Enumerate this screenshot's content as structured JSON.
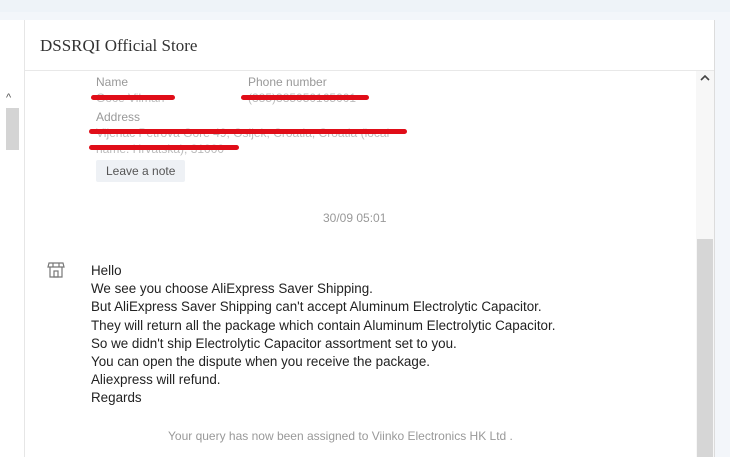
{
  "store": {
    "title": "DSSRQI Official Store"
  },
  "contact": {
    "name_label": "Name",
    "name_value": "Goce Vilman",
    "phone_label": "Phone number",
    "phone_value": "(385)385050165001",
    "address_label": "Address",
    "address_line1": "Vijenac Petrova Gore 49, Osijek, Croatia, Croatia (local",
    "address_line2": "name: Hrvatska), 31000",
    "note_button": "Leave a note"
  },
  "timestamp": "30/09 05:01",
  "message": {
    "lines": [
      "Hello",
      "We see you choose AliExpress Saver Shipping.",
      "But AliExpress Saver Shipping can't accept Aluminum Electrolytic Capacitor.",
      "They will return all the package which contain Aluminum Electrolytic Capacitor.",
      "So we didn't ship Electrolytic Capacitor assortment set to you.",
      "You can open the dispute when you receive the package.",
      "Aliexpress will refund.",
      "Regards"
    ]
  },
  "system_message": "Your query has now been assigned to Viinko Electronics HK Ltd .",
  "colors": {
    "redaction": "#e00d18",
    "muted_text": "#999999",
    "text": "#222222"
  },
  "icons": {
    "store": "store-icon",
    "scroll_up": "chevron-up-icon"
  }
}
